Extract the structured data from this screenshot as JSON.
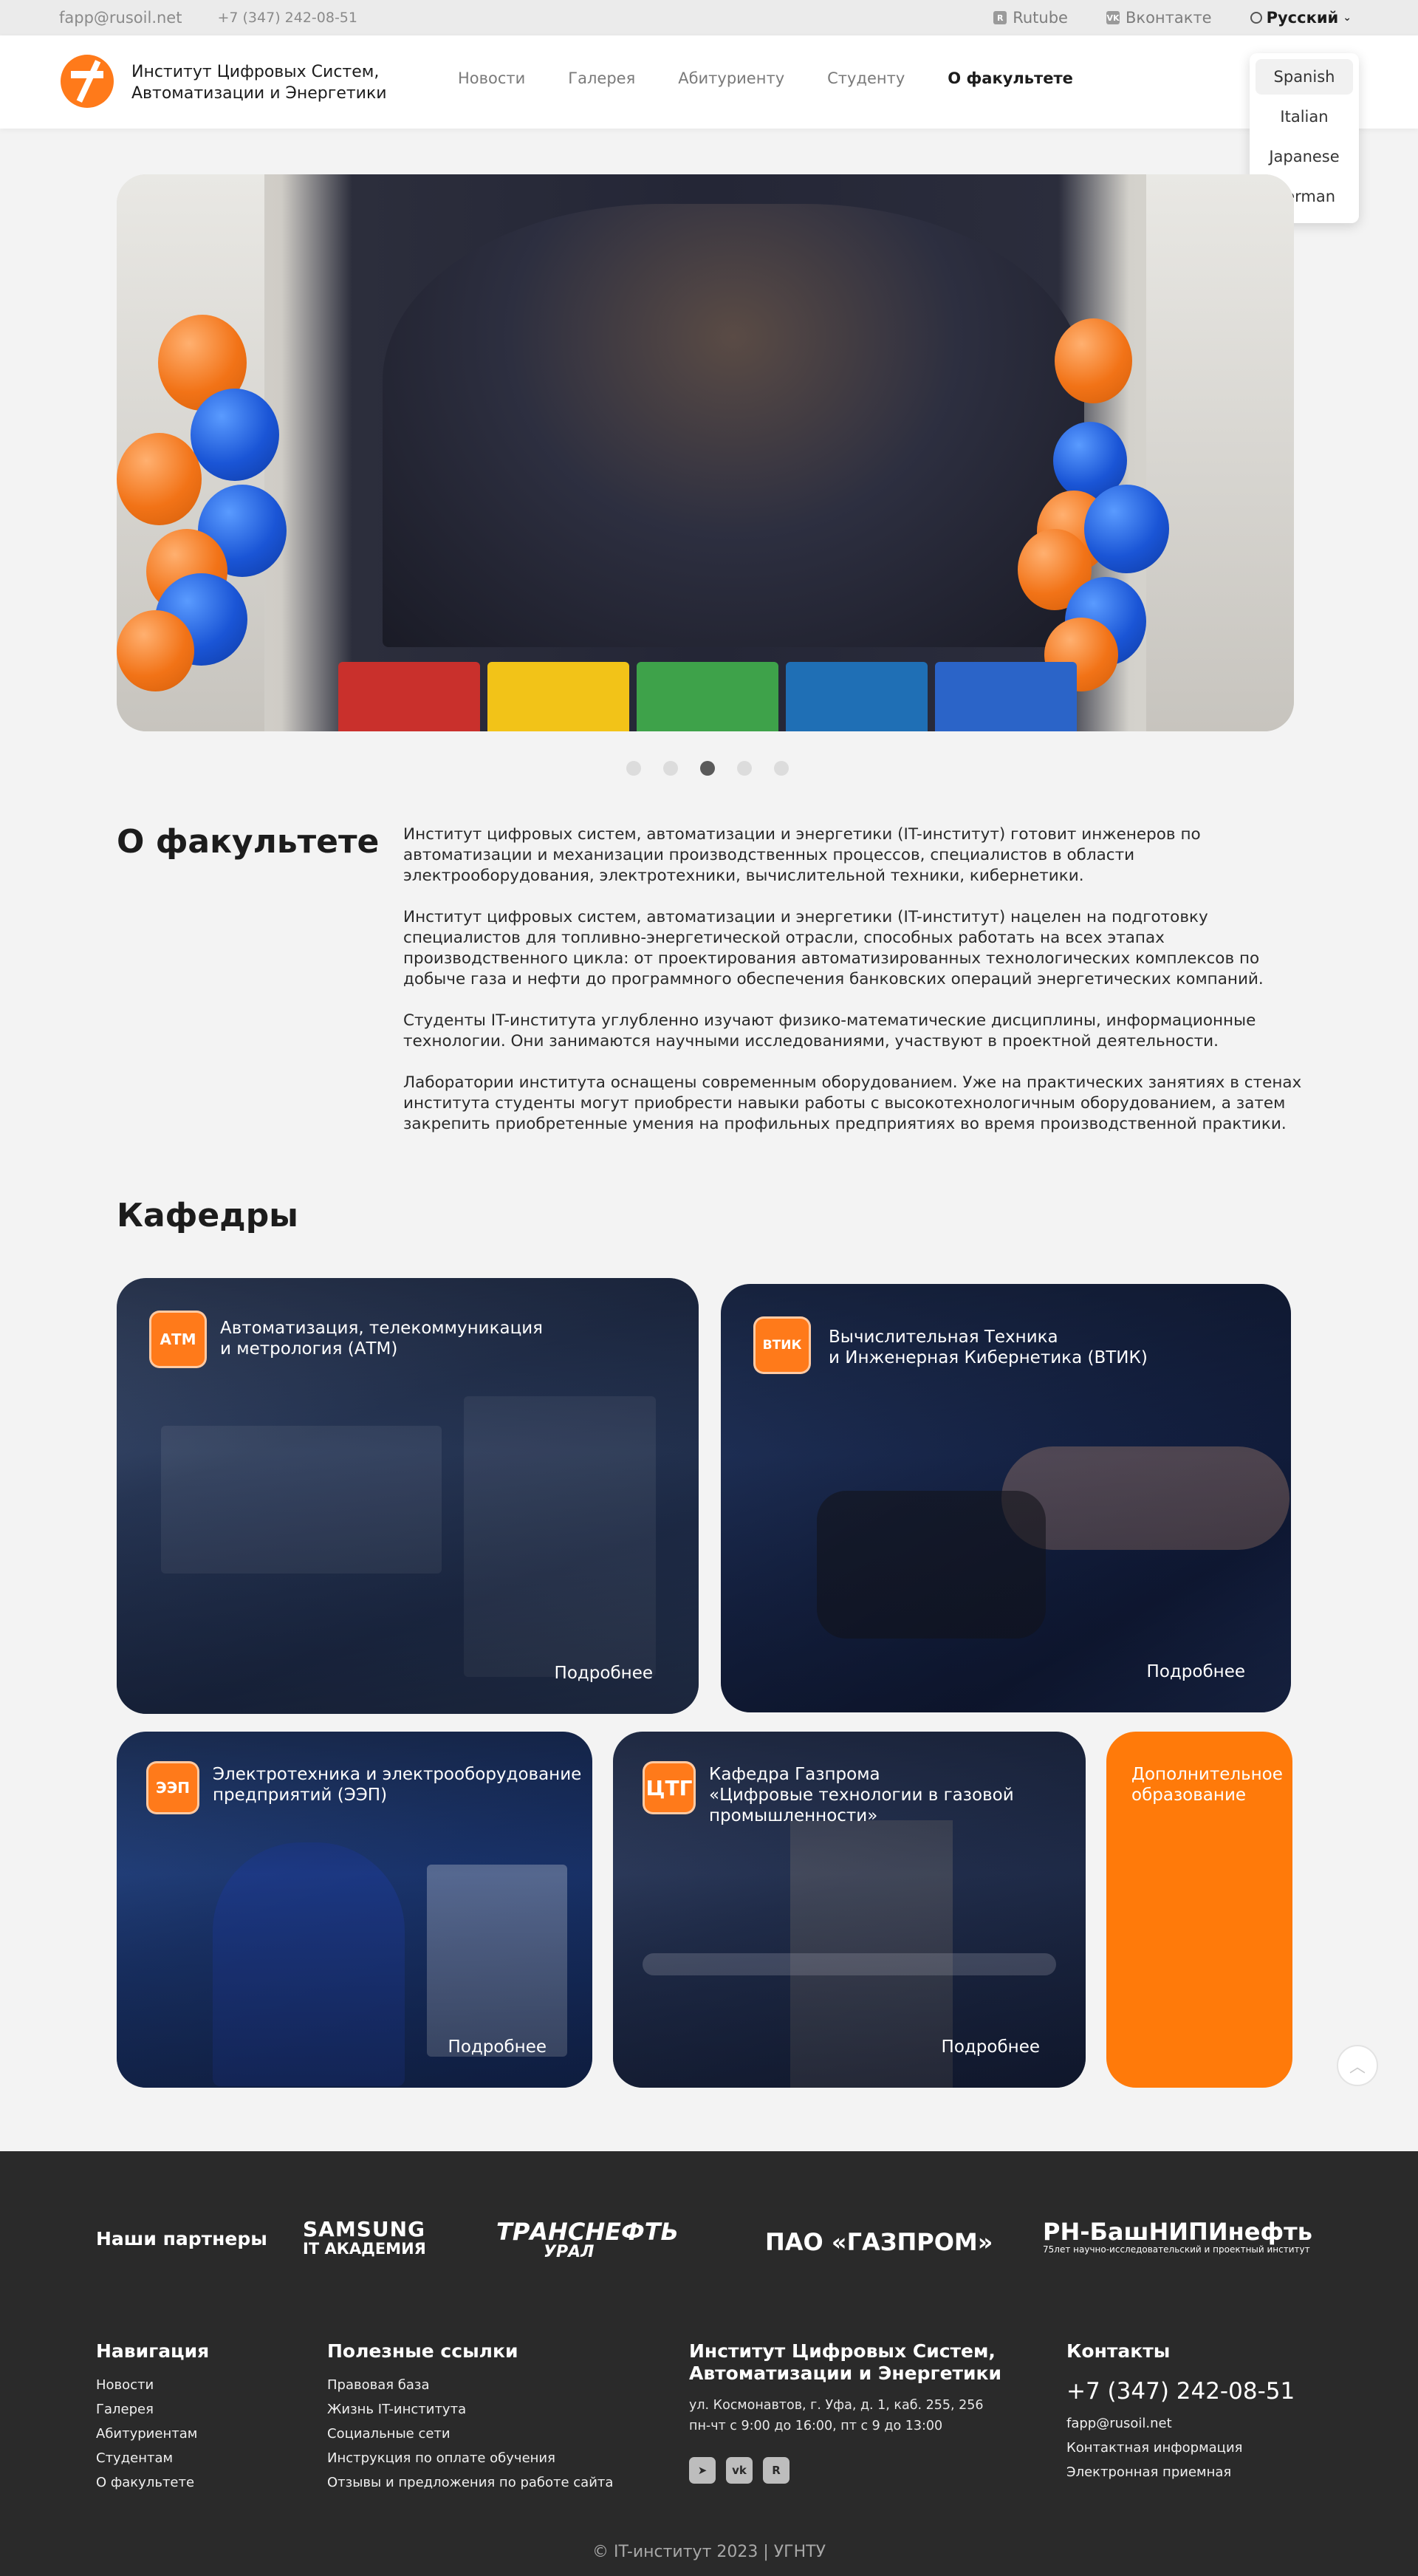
{
  "topbar": {
    "email": "fapp@rusoil.net",
    "phone": "+7 (347) 242-08-51",
    "rutube": "Rutube",
    "vk": "Вконтакте",
    "language": "Русский"
  },
  "header": {
    "brand_line1": "Институт Цифровых Систем,",
    "brand_line2": "Автоматизации и Энергетики",
    "nav": [
      {
        "label": "Новости"
      },
      {
        "label": "Галерея"
      },
      {
        "label": "Абитуриенту"
      },
      {
        "label": "Студенту"
      },
      {
        "label": "О факультете"
      }
    ]
  },
  "language_menu": {
    "options": [
      "Spanish",
      "Italian",
      "Japanese",
      "German"
    ]
  },
  "colors": {
    "accent": "#ff7a0a",
    "footer_bg": "#2a2a2a",
    "page_bg": "#f3f3f3"
  },
  "slider": {
    "dots": 5,
    "active_dot": 3
  },
  "about": {
    "title": "О факультете",
    "paragraphs": [
      "Институт цифровых систем, автоматизации и энергетики (IT-институт) готовит инженеров по автоматизации и механизации производственных процессов, специалистов в области электрооборудования, электротехники, вычислительной техники, кибернетики.",
      "Институт цифровых систем, автоматизации и энергетики (IT-институт) нацелен на подготовку специалистов для топливно-энергетической отрасли, способных работать на всех этапах производственного цикла: от проектирования автоматизированных технологических комплексов по добыче газа и нефти до программного обеспечения банковских операций энергетических компаний.",
      "Студенты IT-института углубленно изучают физико-математические дисциплины, информационные технологии. Они занимаются научными исследованиями, участвуют в проектной деятельности.",
      "Лаборатории института оснащены современным оборудованием. Уже на практических занятиях в стенах института студенты могут приобрести навыки работы с высокотехнологичным оборудованием, а затем закрепить приобретенные умения на профильных предприятиях во время производственной практики."
    ]
  },
  "departments": {
    "title": "Кафедры",
    "more": "Подробнее",
    "items": [
      {
        "title_line1": "Автоматизация, телекоммуникация",
        "title_line2": "и метрология (АТМ)",
        "icon_text": "АТМ"
      },
      {
        "title_line1": "Вычислительная Техника",
        "title_line2": "и Инженерная Кибернетика (ВТИК)",
        "icon_text": "ВТИК"
      },
      {
        "title_line1": "Электротехника и электрооборудование",
        "title_line2": "предприятий (ЭЭП)",
        "icon_text": "ЭЭП"
      },
      {
        "title_line1": "Кафедра Газпрома",
        "title_line2": "«Цифровые технологии в газовой",
        "title_line3": "промышленности»",
        "icon_text": "ЦТГ"
      },
      {
        "title_line1": "Дополнительное",
        "title_line2": "образование"
      }
    ]
  },
  "footer": {
    "partners_label": "Наши партнеры",
    "partners": {
      "samsung": "SAMSUNG",
      "samsung_sub": "IT АКАДЕМИЯ",
      "transneft": "ТРАНСНЕФТЬ",
      "transneft_sub": "УРАЛ",
      "gazprom": "ПАО «ГАЗПРОМ»",
      "rn": "РН-БашНИПИнефть",
      "rn_sub": "научно-исследовательский и проектный институт",
      "rn_years": "75лет"
    },
    "nav_title": "Навигация",
    "nav_links": [
      "Новости",
      "Галерея",
      "Абитуриентам",
      "Студентам",
      "О факультете"
    ],
    "useful_title": "Полезные ссылки",
    "useful_links": [
      "Правовая база",
      "Жизнь IT-института",
      "Социальные сети",
      "Инструкция по оплате обучения",
      "Отзывы и предложения по работе сайта"
    ],
    "inst_title_line1": "Институт Цифровых Систем,",
    "inst_title_line2": "Автоматизации и Энергетики",
    "address": "ул. Космонавтов, г. Уфа, д. 1, каб. 255, 256",
    "hours": "пн-чт с 9:00 до 16:00, пт с 9 до 13:00",
    "contacts_title": "Контакты",
    "contacts_phone": "+7 (347) 242-08-51",
    "contacts_links": [
      "fapp@rusoil.net",
      "Контактная информация",
      "Электронная приемная"
    ],
    "copyright": "© IT-институт 2023 | УГНТУ"
  }
}
